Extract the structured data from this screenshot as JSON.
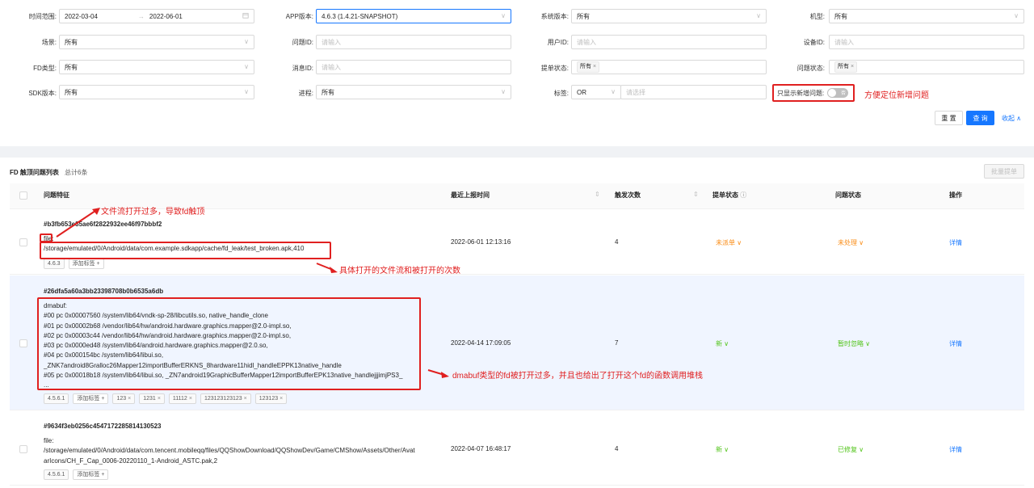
{
  "filters": {
    "time_range": {
      "label": "时间范围:",
      "start": "2022-03-04",
      "arrow": "→",
      "end": "2022-06-01"
    },
    "app_version": {
      "label": "APP版本:",
      "value": "4.6.3 (1.4.21-SNAPSHOT)"
    },
    "os_version": {
      "label": "系统版本:",
      "value": "所有"
    },
    "model": {
      "label": "机型:",
      "value": "所有"
    },
    "scene": {
      "label": "场景:",
      "value": "所有"
    },
    "issue_id": {
      "label": "问题ID:",
      "placeholder": "请输入"
    },
    "user_id": {
      "label": "用户ID:",
      "placeholder": "请输入"
    },
    "device_id": {
      "label": "设备ID:",
      "placeholder": "请输入"
    },
    "fd_type": {
      "label": "FD类型:",
      "value": "所有"
    },
    "message_id": {
      "label": "消息ID:",
      "placeholder": "请输入"
    },
    "ticket_status": {
      "label": "提单状态:",
      "tag": "所有",
      "tag_close": "×"
    },
    "issue_status": {
      "label": "问题状态:",
      "tag": "所有",
      "tag_close": "×"
    },
    "sdk_version": {
      "label": "SDK版本:",
      "value": "所有"
    },
    "process": {
      "label": "进程:",
      "value": "所有"
    },
    "tags": {
      "label": "标签:",
      "op": "OR",
      "placeholder": "请选择"
    },
    "new_only": {
      "label": "只显示新增问题:",
      "toggle_text": "否"
    }
  },
  "annotations": {
    "new_only_hint": "方便定位新增问题",
    "fd_overflow": "文件流打开过多，导致fd触顶",
    "file_count": "具体打开的文件流和被打开的次数",
    "dmabuf_hint": "dmabuf类型的fd被打开过多，并且也给出了打开这个fd的函数调用堆栈"
  },
  "actions": {
    "reset": "重 置",
    "query": "查 询",
    "collapse": "收起 ∧"
  },
  "list": {
    "title": "FD 触顶问题列表",
    "total": "总计6条",
    "batch": "批量提单",
    "columns": {
      "feature": "问题特征",
      "last_report": "最近上报时间",
      "count": "触发次数",
      "ticket": "提单状态",
      "status": "问题状态",
      "ops": "操作"
    },
    "rows": [
      {
        "id": "#b3fb653e85ae6f2822932ee46f97bbbf2",
        "lines": [
          "file:",
          "/storage/emulated/0/Android/data/com.example.sdkapp/cache/fd_leak/test_broken.apk,410"
        ],
        "tags": [
          "4.6.3"
        ],
        "add_tag": "添加标签 +",
        "time": "2022-06-01 12:13:16",
        "count": "4",
        "ticket": "未派单 ∨",
        "status": "未处理 ∨",
        "op": "详情"
      },
      {
        "id": "#26dfa5a60a3bb23398708b0b6535a6db",
        "lines": [
          "dmabuf:",
          "#00 pc 0x00007560 /system/lib64/vndk-sp-28/libcutils.so, native_handle_clone",
          "#01 pc 0x00002b68 /vendor/lib64/hw/android.hardware.graphics.mapper@2.0-impl.so,",
          "#02 pc 0x00003c44 /vendor/lib64/hw/android.hardware.graphics.mapper@2.0-impl.so,",
          "#03 pc 0x0000ed48 /system/lib64/android.hardware.graphics.mapper@2.0.so,",
          "#04 pc 0x000154bc /system/lib64/libui.so,",
          "_ZNK7android8Gralloc26Mapper12importBufferERKNS_8hardware11hidl_handleEPPK13native_handle",
          "#05 pc 0x00018b18 /system/lib64/libui.so, _ZN7android19GraphicBufferMapper12importBufferEPK13native_handlejjjimjPS3_",
          "..."
        ],
        "tags": [
          "4.5.6.1"
        ],
        "add_tag": "添加标签 +",
        "extra_tags": [
          "123",
          "1231",
          "11112",
          "123123123123",
          "123123"
        ],
        "tag_close": "×",
        "time": "2022-04-14 17:09:05",
        "count": "7",
        "ticket": "新 ∨",
        "status": "暂时忽略 ∨",
        "op": "详情"
      },
      {
        "id": "#9634f3eb0256c45471722858141305​23",
        "lines": [
          "file:",
          "/storage/emulated/0/Android/data/com.tencent.mobileqq/files/QQShowDownload/QQShowDev/Game/CMShow/Assets/Other/Avat",
          "arIcons/CH_F_Cap_0006-20220110_1-Android_ASTC.pak,2"
        ],
        "tags": [
          "4.5.6.1"
        ],
        "add_tag": "添加标签 +",
        "time": "2022-04-07 16:48:17",
        "count": "4",
        "ticket": "新 ∨",
        "status": "已修复 ∨",
        "op": "详情"
      }
    ]
  },
  "colors": {
    "primary": "#1677ff",
    "annotation": "#e02020",
    "orange": "#fa8c16",
    "green": "#52c41a"
  }
}
